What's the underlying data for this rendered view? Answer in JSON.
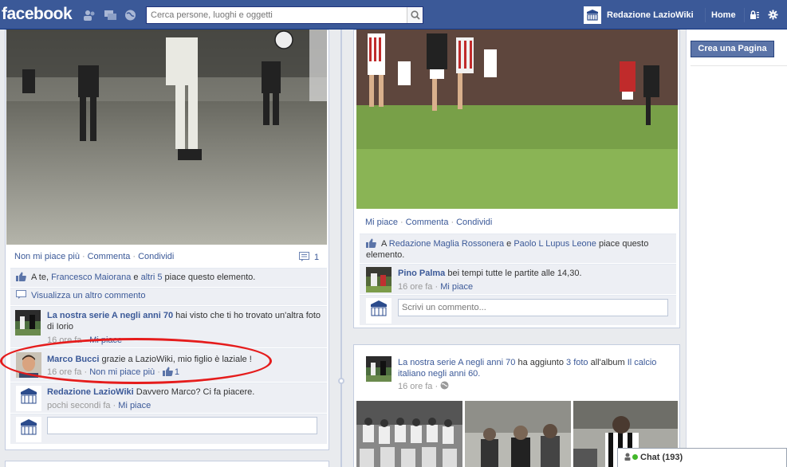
{
  "topbar": {
    "logo": "facebook",
    "search_placeholder": "Cerca persone, luoghi e oggetti",
    "profile_name": "Redazione LazioWiki",
    "home": "Home"
  },
  "post_left": {
    "actions": [
      "Non mi piace più",
      "Commenta",
      "Condividi"
    ],
    "comment_count": "1",
    "likes": {
      "prefix": "A te, ",
      "name1": "Francesco Maiorana",
      "mid": " e ",
      "name2": "altri 5",
      "suffix": " piace questo elemento."
    },
    "view_more": "Visualizza un altro commento",
    "comments": [
      {
        "author": "La nostra serie A negli anni 70",
        "text": " hai visto che ti ho trovato un'altra foto di Iorio",
        "time": "16 ore fa",
        "action": "Mi piace"
      },
      {
        "author": "Marco Bucci",
        "text": " grazie a LazioWiki, mio figlio è laziale !",
        "time": "16 ore fa",
        "action": "Non mi piace più",
        "likes": "1"
      },
      {
        "author": "Redazione LazioWiki",
        "text": " Davvero Marco? Ci fa piacere.",
        "time": "pochi secondi fa",
        "action": "Mi piace"
      }
    ],
    "avatar_caption": "LazioWiki"
  },
  "post_right": {
    "actions": [
      "Mi piace",
      "Commenta",
      "Condividi"
    ],
    "likes": {
      "prefix": "A ",
      "name1": "Redazione Maglia Rossonera",
      "mid": " e ",
      "name2": "Paolo L Lupus Leone",
      "suffix": " piace questo elemento."
    },
    "comment": {
      "author": "Pino Palma",
      "text": " bei tempi tutte le partite alle 14,30.",
      "time": "16 ore fa",
      "action": "Mi piace"
    },
    "input_placeholder": "Scrivi un commento..."
  },
  "post_right2": {
    "author": "La nostra serie A negli anni 70",
    "mid": " ha aggiunto ",
    "photos": "3 foto",
    "mid2": " all'album ",
    "album": "Il calcio italiano negli anni 60.",
    "time": "16 ore fa"
  },
  "sidebar": {
    "create_page": "Crea una Pagina"
  },
  "chat": {
    "label": "Chat (193)"
  },
  "colors": {
    "brand": "#3b5998",
    "annotation": "#e51c1c"
  }
}
